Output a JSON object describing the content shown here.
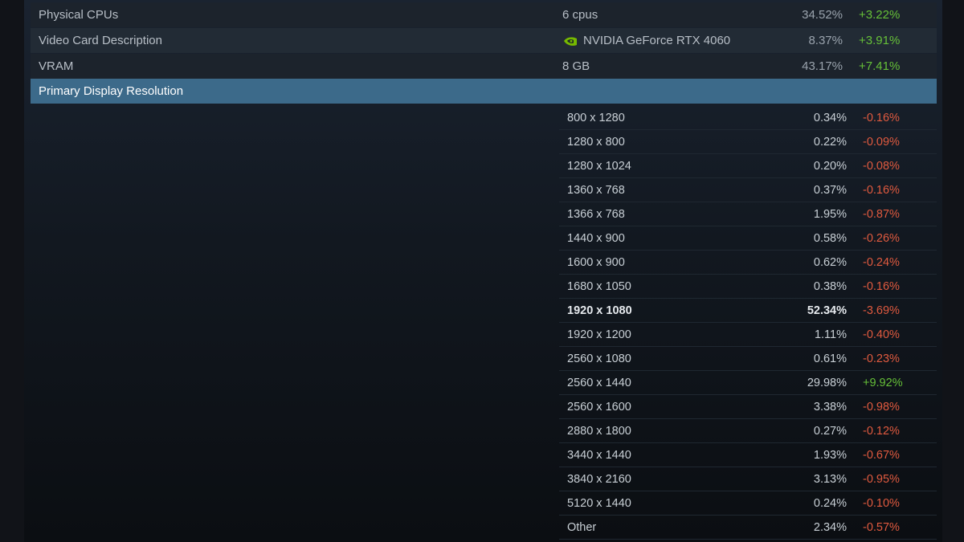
{
  "top_rows": [
    {
      "label": "Physical CPUs",
      "value": "6 cpus",
      "pct": "34.52%",
      "change": "+3.22%"
    },
    {
      "label": "Video Card Description",
      "value": "NVIDIA GeForce RTX 4060",
      "pct": "8.37%",
      "change": "+3.91%",
      "icon": "nvidia-icon"
    },
    {
      "label": "VRAM",
      "value": "8 GB",
      "pct": "43.17%",
      "change": "+7.41%"
    }
  ],
  "section": {
    "title": "Primary Display Resolution"
  },
  "resolutions": [
    {
      "name": "800 x 1280",
      "pct": "0.34%",
      "change": "-0.16%"
    },
    {
      "name": "1280 x 800",
      "pct": "0.22%",
      "change": "-0.09%"
    },
    {
      "name": "1280 x 1024",
      "pct": "0.20%",
      "change": "-0.08%"
    },
    {
      "name": "1360 x 768",
      "pct": "0.37%",
      "change": "-0.16%"
    },
    {
      "name": "1366 x 768",
      "pct": "1.95%",
      "change": "-0.87%"
    },
    {
      "name": "1440 x 900",
      "pct": "0.58%",
      "change": "-0.26%"
    },
    {
      "name": "1600 x 900",
      "pct": "0.62%",
      "change": "-0.24%"
    },
    {
      "name": "1680 x 1050",
      "pct": "0.38%",
      "change": "-0.16%"
    },
    {
      "name": "1920 x 1080",
      "pct": "52.34%",
      "change": "-3.69%"
    },
    {
      "name": "1920 x 1200",
      "pct": "1.11%",
      "change": "-0.40%"
    },
    {
      "name": "2560 x 1080",
      "pct": "0.61%",
      "change": "-0.23%"
    },
    {
      "name": "2560 x 1440",
      "pct": "29.98%",
      "change": "+9.92%"
    },
    {
      "name": "2560 x 1600",
      "pct": "3.38%",
      "change": "-0.98%"
    },
    {
      "name": "2880 x 1800",
      "pct": "0.27%",
      "change": "-0.12%"
    },
    {
      "name": "3440 x 1440",
      "pct": "1.93%",
      "change": "-0.67%"
    },
    {
      "name": "3840 x 2160",
      "pct": "3.13%",
      "change": "-0.95%"
    },
    {
      "name": "5120 x 1440",
      "pct": "0.24%",
      "change": "-0.10%"
    },
    {
      "name": "Other",
      "pct": "2.34%",
      "change": "-0.57%"
    }
  ],
  "colors": {
    "positive": "#66c038",
    "negative": "#e05a3f",
    "header": "#3c6a8a"
  }
}
